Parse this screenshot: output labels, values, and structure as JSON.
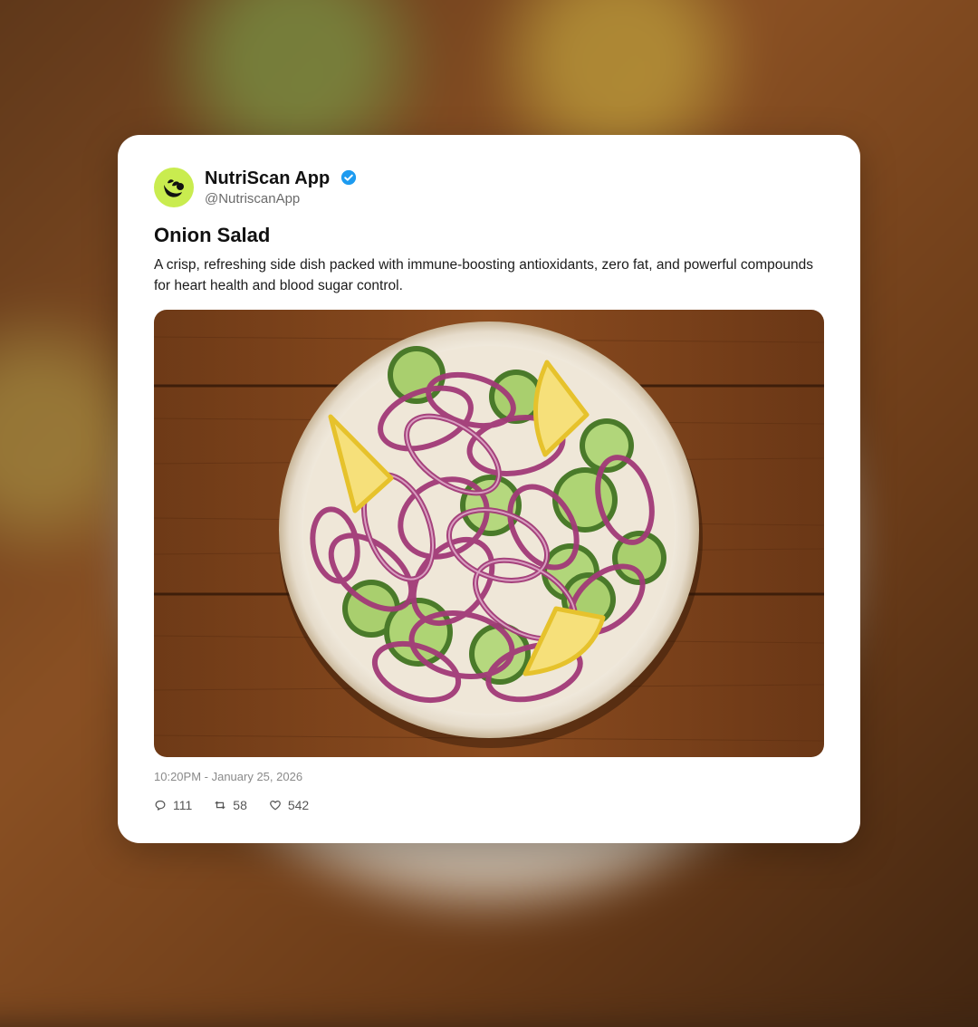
{
  "post": {
    "author_name": "NutriScan App",
    "handle": "@NutriscanApp",
    "verified": true,
    "title": "Onion Salad",
    "description": "A crisp, refreshing side dish packed with immune-boosting antioxidants, zero fat, and powerful compounds for heart health and blood sugar control.",
    "timestamp": "10:20PM - January 25, 2026",
    "stats": {
      "replies": "111",
      "reposts": "58",
      "likes": "542"
    }
  },
  "colors": {
    "avatar_bg": "#c9ec4f",
    "verified_blue": "#1d9bf0",
    "card_bg": "#ffffff"
  },
  "icons": {
    "avatar": "leaf-logo-icon",
    "verified": "verified-badge-icon",
    "replies": "reply-icon",
    "reposts": "repost-icon",
    "likes": "heart-icon"
  }
}
